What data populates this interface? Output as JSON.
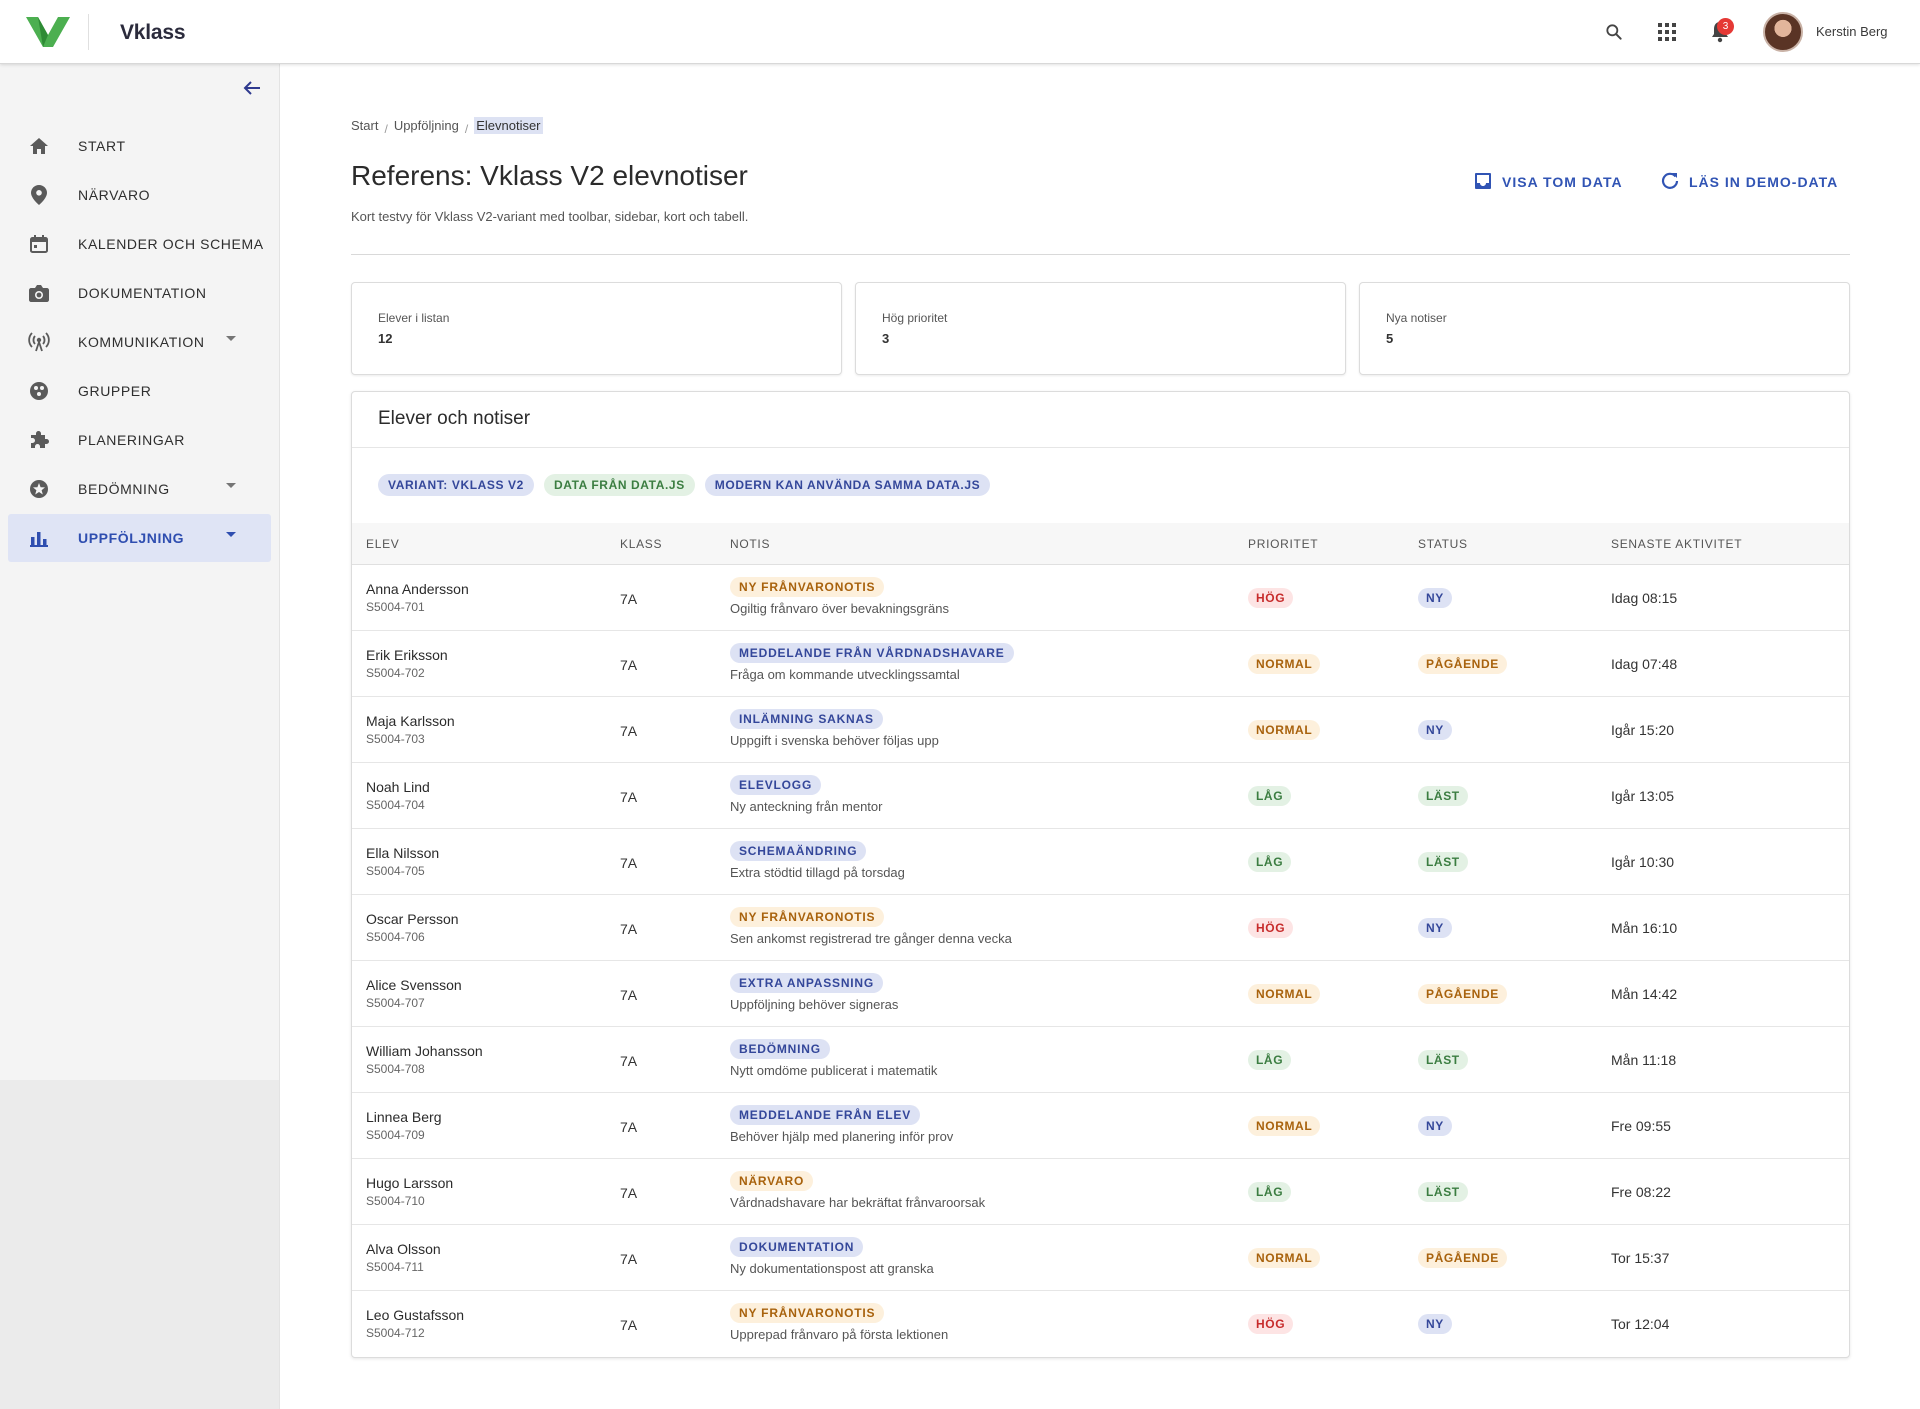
{
  "header": {
    "brand": "Vklass",
    "notification_count": "3",
    "user_name": "Kerstin Berg",
    "icons": [
      "search-icon",
      "apps-grid-icon",
      "bell-icon"
    ]
  },
  "sidebar": {
    "items": [
      {
        "label": "START",
        "icon": "home-icon",
        "has_caret": false,
        "active": false
      },
      {
        "label": "NÄRVARO",
        "icon": "location-pin-icon",
        "has_caret": false,
        "active": false
      },
      {
        "label": "KALENDER OCH SCHEMA",
        "icon": "calendar-icon",
        "has_caret": false,
        "active": false
      },
      {
        "label": "DOKUMENTATION",
        "icon": "camera-icon",
        "has_caret": false,
        "active": false
      },
      {
        "label": "KOMMUNIKATION",
        "icon": "broadcast-icon",
        "has_caret": true,
        "active": false
      },
      {
        "label": "GRUPPER",
        "icon": "group-icon",
        "has_caret": false,
        "active": false
      },
      {
        "label": "PLANERINGAR",
        "icon": "puzzle-icon",
        "has_caret": false,
        "active": false
      },
      {
        "label": "BEDÖMNING",
        "icon": "star-circle-icon",
        "has_caret": true,
        "active": false
      },
      {
        "label": "UPPFÖLJNING",
        "icon": "bar-chart-icon",
        "has_caret": true,
        "active": true
      }
    ]
  },
  "breadcrumb": {
    "items": [
      "Start",
      "Uppföljning",
      "Elevnotiser"
    ],
    "separator": "/"
  },
  "page": {
    "title": "Referens: Vklass V2 elevnotiser",
    "subtitle": "Kort testvy för Vklass V2-variant med toolbar, sidebar, kort och tabell.",
    "actions": {
      "empty_label": "VISA TOM DATA",
      "demo_label": "LÄS IN DEMO-DATA"
    }
  },
  "stats": [
    {
      "label": "Elever i listan",
      "value": "12"
    },
    {
      "label": "Hög prioritet",
      "value": "3"
    },
    {
      "label": "Nya notiser",
      "value": "5"
    }
  ],
  "table": {
    "title": "Elever och notiser",
    "chips": [
      {
        "label": "VARIANT: VKLASS V2",
        "tone": "blue"
      },
      {
        "label": "DATA FRÅN DATA.JS",
        "tone": "green"
      },
      {
        "label": "MODERN KAN ANVÄNDA SAMMA DATA.JS",
        "tone": "blue"
      }
    ],
    "columns": [
      "ELEV",
      "KLASS",
      "NOTIS",
      "PRIORITET",
      "STATUS",
      "SENASTE AKTIVITET"
    ],
    "rows": [
      {
        "name": "Anna Andersson",
        "id": "S5004-701",
        "klass": "7A",
        "type": "NY FRÅNVARONOTIS",
        "type_tone": "orange",
        "text": "Ogiltig frånvaro över bevakningsgräns",
        "prio": "HÖG",
        "prio_tone": "red",
        "status": "NY",
        "status_tone": "blue",
        "time": "Idag 08:15"
      },
      {
        "name": "Erik Eriksson",
        "id": "S5004-702",
        "klass": "7A",
        "type": "MEDDELANDE FRÅN VÅRDNADSHAVARE",
        "type_tone": "blue",
        "text": "Fråga om kommande utvecklingssamtal",
        "prio": "NORMAL",
        "prio_tone": "orange",
        "status": "PÅGÅENDE",
        "status_tone": "orange",
        "time": "Idag 07:48"
      },
      {
        "name": "Maja Karlsson",
        "id": "S5004-703",
        "klass": "7A",
        "type": "INLÄMNING SAKNAS",
        "type_tone": "blue",
        "text": "Uppgift i svenska behöver följas upp",
        "prio": "NORMAL",
        "prio_tone": "orange",
        "status": "NY",
        "status_tone": "blue",
        "time": "Igår 15:20"
      },
      {
        "name": "Noah Lind",
        "id": "S5004-704",
        "klass": "7A",
        "type": "ELEVLOGG",
        "type_tone": "blue",
        "text": "Ny anteckning från mentor",
        "prio": "LÅG",
        "prio_tone": "green",
        "status": "LÄST",
        "status_tone": "green",
        "time": "Igår 13:05"
      },
      {
        "name": "Ella Nilsson",
        "id": "S5004-705",
        "klass": "7A",
        "type": "SCHEMAÄNDRING",
        "type_tone": "blue",
        "text": "Extra stödtid tillagd på torsdag",
        "prio": "LÅG",
        "prio_tone": "green",
        "status": "LÄST",
        "status_tone": "green",
        "time": "Igår 10:30"
      },
      {
        "name": "Oscar Persson",
        "id": "S5004-706",
        "klass": "7A",
        "type": "NY FRÅNVARONOTIS",
        "type_tone": "orange",
        "text": "Sen ankomst registrerad tre gånger denna vecka",
        "prio": "HÖG",
        "prio_tone": "red",
        "status": "NY",
        "status_tone": "blue",
        "time": "Mån 16:10"
      },
      {
        "name": "Alice Svensson",
        "id": "S5004-707",
        "klass": "7A",
        "type": "EXTRA ANPASSNING",
        "type_tone": "blue",
        "text": "Uppföljning behöver signeras",
        "prio": "NORMAL",
        "prio_tone": "orange",
        "status": "PÅGÅENDE",
        "status_tone": "orange",
        "time": "Mån 14:42"
      },
      {
        "name": "William Johansson",
        "id": "S5004-708",
        "klass": "7A",
        "type": "BEDÖMNING",
        "type_tone": "blue",
        "text": "Nytt omdöme publicerat i matematik",
        "prio": "LÅG",
        "prio_tone": "green",
        "status": "LÄST",
        "status_tone": "green",
        "time": "Mån 11:18"
      },
      {
        "name": "Linnea Berg",
        "id": "S5004-709",
        "klass": "7A",
        "type": "MEDDELANDE FRÅN ELEV",
        "type_tone": "blue",
        "text": "Behöver hjälp med planering inför prov",
        "prio": "NORMAL",
        "prio_tone": "orange",
        "status": "NY",
        "status_tone": "blue",
        "time": "Fre 09:55"
      },
      {
        "name": "Hugo Larsson",
        "id": "S5004-710",
        "klass": "7A",
        "type": "NÄRVARO",
        "type_tone": "orange",
        "text": "Vårdnadshavare har bekräftat frånvaroorsak",
        "prio": "LÅG",
        "prio_tone": "green",
        "status": "LÄST",
        "status_tone": "green",
        "time": "Fre 08:22"
      },
      {
        "name": "Alva Olsson",
        "id": "S5004-711",
        "klass": "7A",
        "type": "DOKUMENTATION",
        "type_tone": "blue",
        "text": "Ny dokumentationspost att granska",
        "prio": "NORMAL",
        "prio_tone": "orange",
        "status": "PÅGÅENDE",
        "status_tone": "orange",
        "time": "Tor 15:37"
      },
      {
        "name": "Leo Gustafsson",
        "id": "S5004-712",
        "klass": "7A",
        "type": "NY FRÅNVARONOTIS",
        "type_tone": "orange",
        "text": "Upprepad frånvaro på första lektionen",
        "prio": "HÖG",
        "prio_tone": "red",
        "status": "NY",
        "status_tone": "blue",
        "time": "Tor 12:04"
      }
    ]
  },
  "colors": {
    "accent": "#3154b4",
    "logo_green": "#4caf50",
    "active_nav_bg": "#dfe4f5",
    "badge_red": "#e53935"
  }
}
